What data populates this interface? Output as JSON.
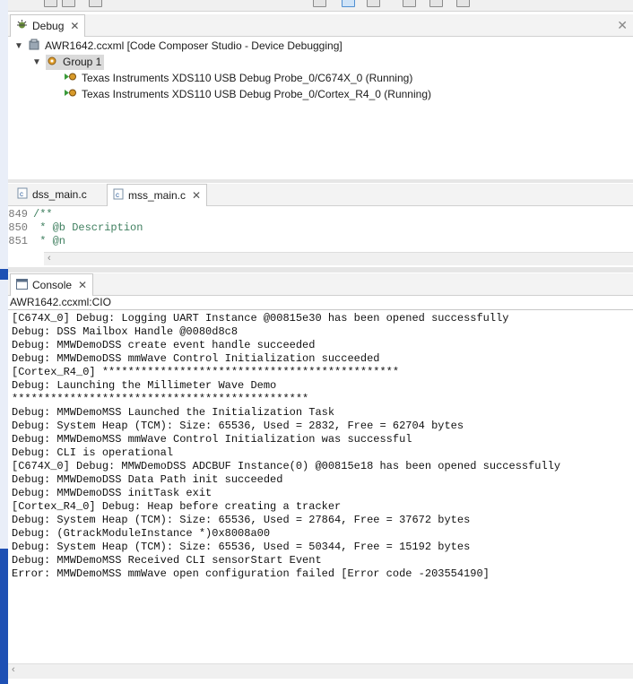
{
  "debug_view": {
    "tab_label": "Debug",
    "tree": {
      "root": "AWR1642.ccxml [Code Composer Studio - Device Debugging]",
      "group": "Group 1",
      "cores": [
        "Texas Instruments XDS110 USB Debug Probe_0/C674X_0 (Running)",
        "Texas Instruments XDS110 USB Debug Probe_0/Cortex_R4_0 (Running)"
      ]
    }
  },
  "editor": {
    "tabs": [
      {
        "label": "dss_main.c",
        "active": false
      },
      {
        "label": "mss_main.c",
        "active": true
      }
    ],
    "lines": [
      {
        "num": "849",
        "text": "/**"
      },
      {
        "num": "850",
        "text": " *  @b Description"
      },
      {
        "num": "851",
        "text": " *  @n"
      }
    ]
  },
  "console": {
    "tab_label": "Console",
    "session": "AWR1642.ccxml:CIO",
    "lines": [
      "[C674X_0] Debug: Logging UART Instance @00815e30 has been opened successfully",
      "Debug: DSS Mailbox Handle @0080d8c8",
      "Debug: MMWDemoDSS create event handle succeeded",
      "Debug: MMWDemoDSS mmWave Control Initialization succeeded",
      "[Cortex_R4_0] **********************************************",
      "Debug: Launching the Millimeter Wave Demo",
      "**********************************************",
      "Debug: MMWDemoMSS Launched the Initialization Task",
      "Debug: System Heap (TCM): Size: 65536, Used = 2832, Free = 62704 bytes",
      "Debug: MMWDemoMSS mmWave Control Initialization was successful",
      "Debug: CLI is operational",
      "[C674X_0] Debug: MMWDemoDSS ADCBUF Instance(0) @00815e18 has been opened successfully",
      "Debug: MMWDemoDSS Data Path init succeeded",
      "Debug: MMWDemoDSS initTask exit",
      "[Cortex_R4_0] Debug: Heap before creating a tracker",
      "Debug: System Heap (TCM): Size: 65536, Used = 27864, Free = 37672 bytes",
      "Debug: (GtrackModuleInstance *)0x8008a00",
      "Debug: System Heap (TCM): Size: 65536, Used = 50344, Free = 15192 bytes",
      "Debug: MMWDemoMSS Received CLI sensorStart Event",
      "Error: MMWDemoMSS mmWave open configuration failed [Error code -203554190]"
    ]
  },
  "colors": {
    "comment": "#3f7f5f",
    "line_number": "#787878",
    "running_icon": "#3a9a3a",
    "left_window": "#1e50b4"
  },
  "icons": {
    "debug_tab": "debug-bug-icon",
    "close": "close-x-icon",
    "maximize": "pin-icon",
    "root": "device-config-icon",
    "group": "group-gear-icon",
    "core": "running-core-icon",
    "c_file": "c-source-file-icon",
    "console": "console-icon"
  }
}
